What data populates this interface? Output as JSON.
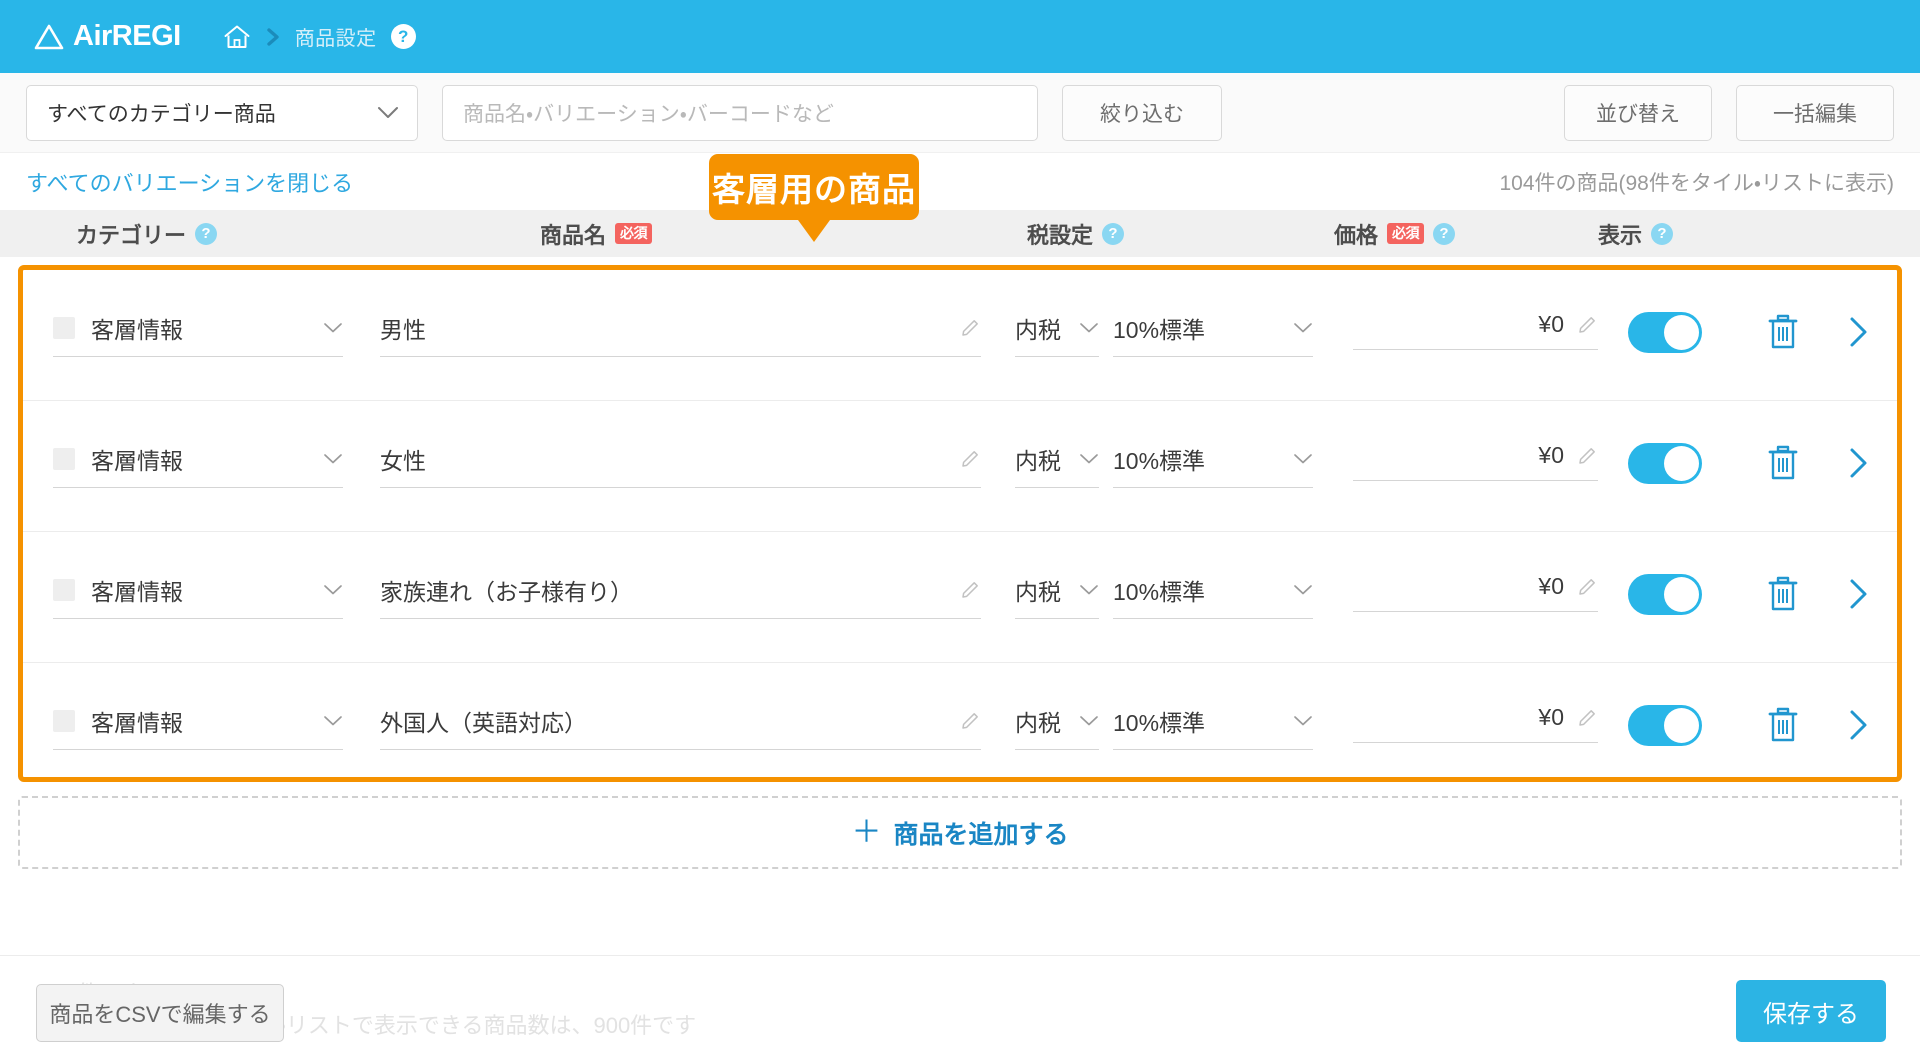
{
  "header": {
    "brand": "AirREGI",
    "home_icon": "home-icon",
    "separator_icon": "chevron-right-icon",
    "breadcrumb_current": "商品設定",
    "help_badge": "?",
    "bg_color": "#29b6e8"
  },
  "toolbar": {
    "category_filter_value": "すべてのカテゴリー商品",
    "search_placeholder": "商品名・バリエーション・バーコードなど",
    "search_value": "",
    "filter_button": "絞り込む",
    "sort_button": "並び替え",
    "bulk_edit_button": "一括編集"
  },
  "subbar": {
    "close_all_variations": "すべてのバリエーションを閉じる",
    "count_text": "104件の商品(98件をタイル・リストに表示)"
  },
  "callout": {
    "text": "客層用の商品",
    "color": "#f59200"
  },
  "table": {
    "columns": [
      {
        "label": "カテゴリー",
        "help": "?",
        "required": null
      },
      {
        "label": "商品名",
        "help": null,
        "required": "必須"
      },
      {
        "label": "税設定",
        "help": "?",
        "required": null
      },
      {
        "label": "価格",
        "help": "?",
        "required": "必須"
      },
      {
        "label": "表示",
        "help": "?",
        "required": null
      }
    ],
    "rows": [
      {
        "checked": false,
        "category": "客層情報",
        "name": "男性",
        "tax_type": "内税",
        "tax_rate": "10%標準",
        "price": "¥0",
        "visible": true
      },
      {
        "checked": false,
        "category": "客層情報",
        "name": "女性",
        "tax_type": "内税",
        "tax_rate": "10%標準",
        "price": "¥0",
        "visible": true
      },
      {
        "checked": false,
        "category": "客層情報",
        "name": "家族連れ（お子様有り）",
        "tax_type": "内税",
        "tax_rate": "10%標準",
        "price": "¥0",
        "visible": true
      },
      {
        "checked": false,
        "category": "客層情報",
        "name": "外国人（英語対応）",
        "tax_type": "内税",
        "tax_rate": "10%標準",
        "price": "¥0",
        "visible": true
      }
    ]
  },
  "add_row": {
    "plus": "＋",
    "label": "商品を追加する"
  },
  "footer": {
    "csv_button": "商品をCSVで編集する",
    "note_line_1": "000件です",
    "note_line_2": "※注文入力画面のタイル・リストで表示できる商品数は、900件です",
    "save_button": "保存する"
  }
}
